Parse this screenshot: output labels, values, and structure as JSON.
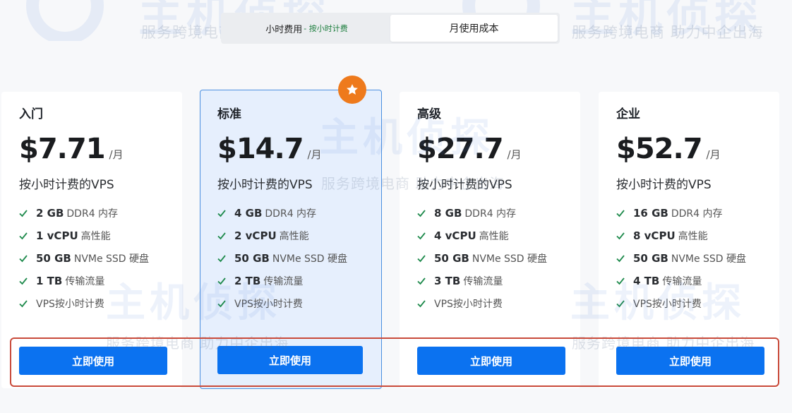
{
  "toggle": {
    "hourly_label": "小时费用",
    "hourly_note": "- 按小时计费",
    "monthly_label": "月使用成本"
  },
  "watermark": {
    "brand": "主机侦探",
    "slogan": "服务跨境电商 助力中企出海"
  },
  "plans": [
    {
      "name": "入门",
      "price": "$7.71",
      "unit": "/月",
      "desc": "按小时计费的VPS",
      "features": [
        {
          "strong": "2 GB",
          "text": "DDR4 内存"
        },
        {
          "strong": "1 vCPU",
          "text": "高性能"
        },
        {
          "strong": "50 GB",
          "text": "NVMe SSD 硬盘"
        },
        {
          "strong": "1 TB",
          "text": "传输流量"
        },
        {
          "strong": "",
          "text": "VPS按小时计费"
        }
      ],
      "cta": "立即使用"
    },
    {
      "name": "标准",
      "price": "$14.7",
      "unit": "/月",
      "desc": "按小时计费的VPS",
      "features": [
        {
          "strong": "4 GB",
          "text": "DDR4 内存"
        },
        {
          "strong": "2 vCPU",
          "text": "高性能"
        },
        {
          "strong": "50 GB",
          "text": "NVMe SSD 硬盘"
        },
        {
          "strong": "2 TB",
          "text": "传输流量"
        },
        {
          "strong": "",
          "text": "VPS按小时计费"
        }
      ],
      "cta": "立即使用"
    },
    {
      "name": "高级",
      "price": "$27.7",
      "unit": "/月",
      "desc": "按小时计费的VPS",
      "features": [
        {
          "strong": "8 GB",
          "text": "DDR4 内存"
        },
        {
          "strong": "4 vCPU",
          "text": "高性能"
        },
        {
          "strong": "50 GB",
          "text": "NVMe SSD 硬盘"
        },
        {
          "strong": "3 TB",
          "text": "传输流量"
        },
        {
          "strong": "",
          "text": "VPS按小时计费"
        }
      ],
      "cta": "立即使用"
    },
    {
      "name": "企业",
      "price": "$52.7",
      "unit": "/月",
      "desc": "按小时计费的VPS",
      "features": [
        {
          "strong": "16 GB",
          "text": "DDR4 内存"
        },
        {
          "strong": "8 vCPU",
          "text": "高性能"
        },
        {
          "strong": "50 GB",
          "text": "NVMe SSD 硬盘"
        },
        {
          "strong": "4 TB",
          "text": "传输流量"
        },
        {
          "strong": "",
          "text": "VPS按小时计费"
        }
      ],
      "cta": "立即使用"
    }
  ],
  "featured_badge_icon": "star-icon",
  "colors": {
    "accent": "#0b72f0",
    "badge": "#ee7a1c",
    "check": "#1e8a4c",
    "highlight": "#c94a3a",
    "featured_bg": "#e6effd"
  }
}
